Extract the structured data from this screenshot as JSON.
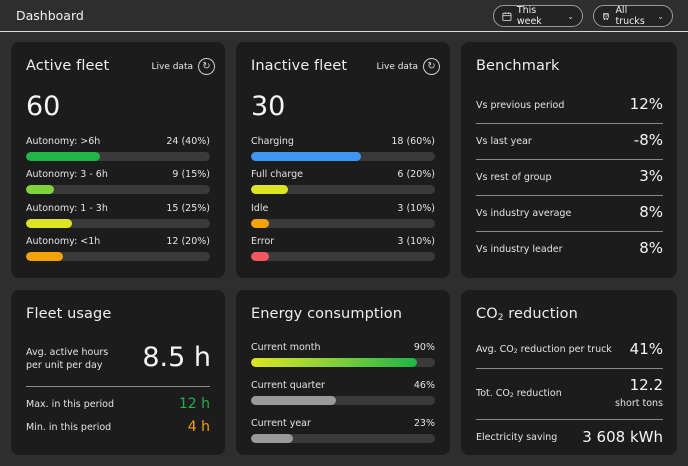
{
  "header": {
    "title": "Dashboard",
    "period_label": "This week",
    "trucks_label": "All trucks"
  },
  "active_fleet": {
    "title": "Active fleet",
    "live_label": "Live data",
    "total": "60",
    "rows": [
      {
        "label": "Autonomy: >6h",
        "value": "24 (40%)",
        "fraction": 0.4,
        "color": "#1fb548"
      },
      {
        "label": "Autonomy: 3 - 6h",
        "value": "9 (15%)",
        "fraction": 0.15,
        "color": "#7fd23a"
      },
      {
        "label": "Autonomy: 1 - 3h",
        "value": "15 (25%)",
        "fraction": 0.25,
        "color": "#dde522"
      },
      {
        "label": "Autonomy: <1h",
        "value": "12 (20%)",
        "fraction": 0.2,
        "color": "#f5a20a"
      }
    ]
  },
  "inactive_fleet": {
    "title": "Inactive fleet",
    "live_label": "Live data",
    "total": "30",
    "rows": [
      {
        "label": "Charging",
        "value": "18 (60%)",
        "fraction": 0.6,
        "color": "#3d97f2"
      },
      {
        "label": "Full charge",
        "value": "6 (20%)",
        "fraction": 0.2,
        "color": "#dde522"
      },
      {
        "label": "Idle",
        "value": "3 (10%)",
        "fraction": 0.1,
        "color": "#f5a20a"
      },
      {
        "label": "Error",
        "value": "3 (10%)",
        "fraction": 0.1,
        "color": "#f2565f"
      }
    ]
  },
  "benchmark": {
    "title": "Benchmark",
    "rows": [
      {
        "label": "Vs previous period",
        "value": "12%"
      },
      {
        "label": "Vs last year",
        "value": "-8%"
      },
      {
        "label": "Vs rest of group",
        "value": "3%"
      },
      {
        "label": "Vs industry average",
        "value": "8%"
      },
      {
        "label": "Vs industry leader",
        "value": "8%"
      }
    ]
  },
  "fleet_usage": {
    "title": "Fleet usage",
    "avg_label_line1": "Avg. active hours",
    "avg_label_line2": "per unit per day",
    "avg_value": "8.5 h",
    "max_label": "Max. in this period",
    "max_value": "12 h",
    "max_color": "#22b14c",
    "min_label": "Min. in this period",
    "min_value": "4 h",
    "min_color": "#f5a20a"
  },
  "energy": {
    "title": "Energy consumption",
    "rows": [
      {
        "label": "Current month",
        "value": "90%",
        "fraction": 0.9,
        "color": "gradient"
      },
      {
        "label": "Current quarter",
        "value": "46%",
        "fraction": 0.46,
        "color": "#9a9a9a"
      },
      {
        "label": "Current year",
        "value": "23%",
        "fraction": 0.23,
        "color": "#9a9a9a"
      }
    ]
  },
  "co2": {
    "title_prefix": "CO",
    "title_sub": "2",
    "title_suffix": " reduction",
    "per_truck_prefix": "Avg. CO",
    "per_truck_sub": "2",
    "per_truck_suffix": " reduction per truck",
    "per_truck_value": "41%",
    "total_prefix": "Tot. CO",
    "total_sub": "2",
    "total_suffix": " reduction",
    "total_value": "12.2",
    "total_unit": "short tons",
    "electricity_label": "Electricity saving",
    "electricity_value": "3 608 kWh"
  }
}
